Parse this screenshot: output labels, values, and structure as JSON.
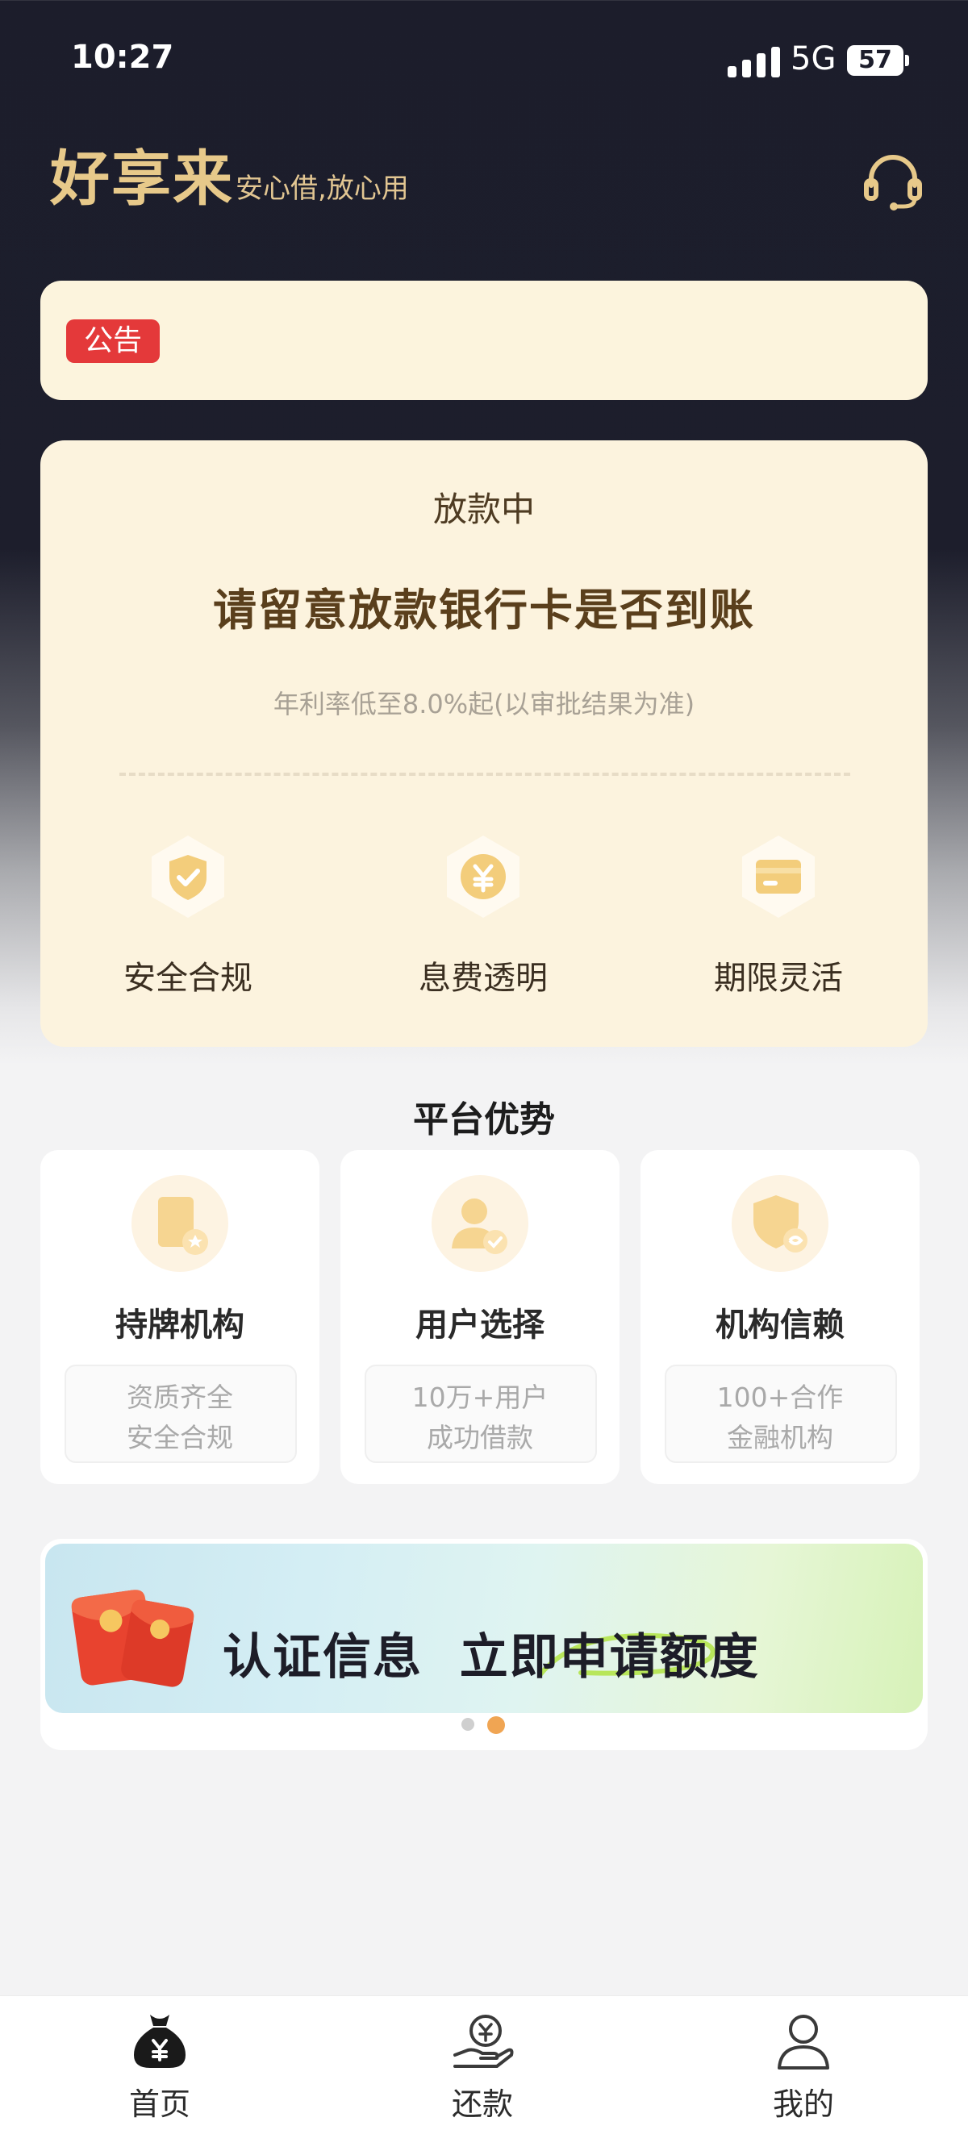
{
  "status_bar": {
    "time": "10:27",
    "network": "5G",
    "battery": "57"
  },
  "header": {
    "app_name": "好享来",
    "slogan": "安心借,放心用",
    "service_icon": "headset-icon"
  },
  "notice": {
    "tag": "公告"
  },
  "loan_card": {
    "status": "放款中",
    "message": "请留意放款银行卡是否到账",
    "rate_note": "年利率低至8.0%起(以审批结果为准)",
    "features": [
      {
        "label": "安全合规",
        "icon": "shield-check-icon"
      },
      {
        "label": "息费透明",
        "icon": "yuan-coin-icon"
      },
      {
        "label": "期限灵活",
        "icon": "card-icon"
      }
    ]
  },
  "advantages": {
    "title": "平台优势",
    "items": [
      {
        "title": "持牌机构",
        "lines": [
          "资质齐全",
          "安全合规"
        ],
        "icon": "license-icon"
      },
      {
        "title": "用户选择",
        "lines": [
          "10万+用户",
          "成功借款"
        ],
        "icon": "user-check-icon"
      },
      {
        "title": "机构信赖",
        "lines": [
          "100+合作",
          "金融机构"
        ],
        "icon": "trust-shield-icon"
      }
    ]
  },
  "banner": {
    "text": "认证信息  立即申请额度",
    "active_page": 2,
    "total_pages": 2,
    "icon": "red-envelope-icon"
  },
  "tabs": [
    {
      "label": "首页",
      "icon": "money-bag-icon",
      "active": true
    },
    {
      "label": "还款",
      "icon": "repay-hand-icon",
      "active": false
    },
    {
      "label": "我的",
      "icon": "profile-icon",
      "active": false
    }
  ],
  "colors": {
    "accent_gold": "#e7c98a",
    "card_bg": "#fcf3de",
    "notice_red": "#e4393a",
    "dot_active": "#f0a553"
  }
}
